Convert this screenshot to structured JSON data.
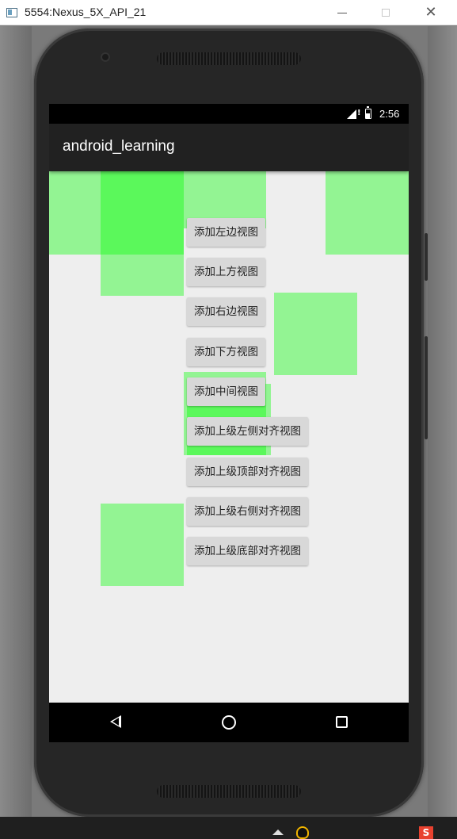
{
  "window": {
    "title": "5554:Nexus_5X_API_21",
    "minimize_glyph": "—",
    "maximize_glyph": "□",
    "close_glyph": "✕",
    "icon": "emulator-window-icon"
  },
  "status_bar": {
    "time": "2:56",
    "signal_badge": "!",
    "icons": [
      "signal-icon",
      "battery-icon"
    ]
  },
  "app_bar": {
    "title": "android_learning"
  },
  "buttons": [
    {
      "label": "添加左边视图"
    },
    {
      "label": "添加上方视图"
    },
    {
      "label": "添加右边视图"
    },
    {
      "label": "添加下方视图"
    },
    {
      "label": "添加中间视图"
    },
    {
      "label": "添加上级左侧对齐视图"
    },
    {
      "label": "添加上级顶部对齐视图"
    },
    {
      "label": "添加上级右侧对齐视图"
    },
    {
      "label": "添加上级底部对齐视图"
    }
  ],
  "added_views": {
    "count": 10,
    "color": "#00ff00",
    "opacity": 0.38
  },
  "nav_bar": {
    "icons": [
      "back-icon",
      "home-icon",
      "recents-icon"
    ]
  },
  "taskbar": {
    "sogou_glyph": "S",
    "icons": [
      "tray-expand-icon",
      "qq-icon",
      "sogou-ime-icon"
    ]
  },
  "colors": {
    "app_bar": "#212121",
    "screen_bg": "#eeeeee",
    "button_bg": "#d8d8d8",
    "view_green": "#00ff00"
  }
}
